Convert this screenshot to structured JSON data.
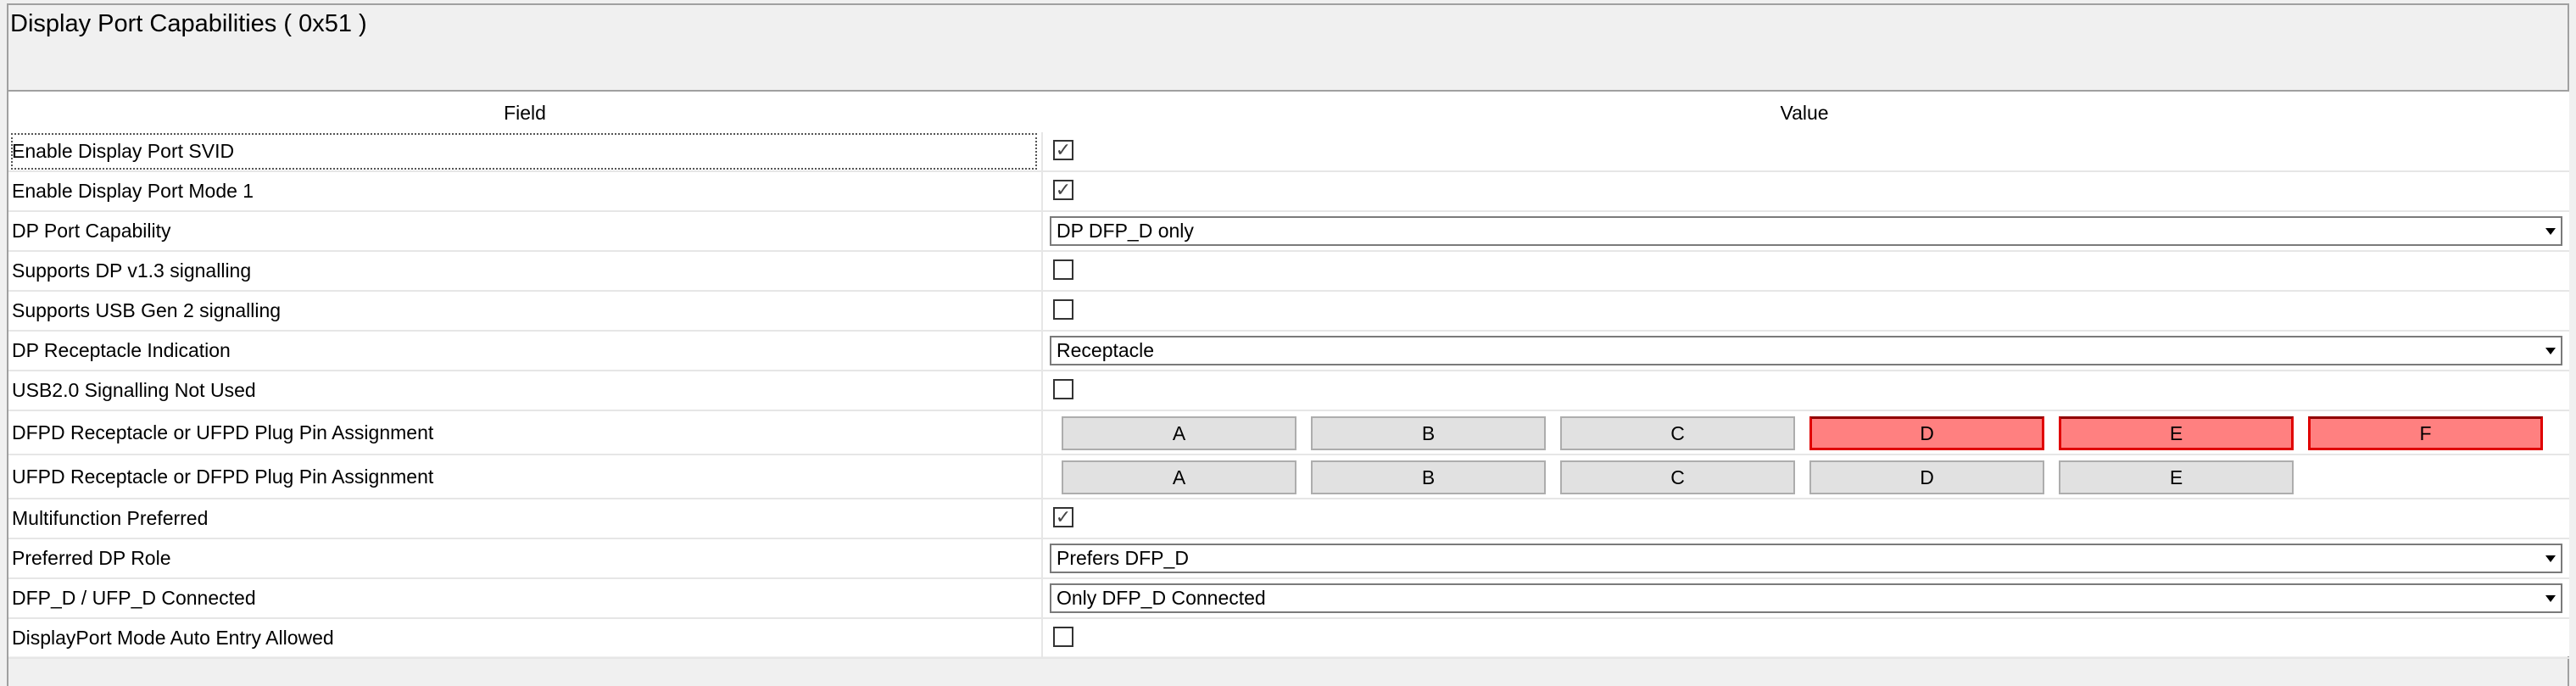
{
  "title": "Display Port Capabilities  ( 0x51 )",
  "columns": {
    "field": "Field",
    "value": "Value"
  },
  "colors": {
    "selected_pin": "#ff8080",
    "selected_pin_border": "#e00000",
    "pin_button": "#e1e1e1"
  },
  "rows": [
    {
      "label": "Enable Display Port SVID",
      "type": "checkbox",
      "checked": true
    },
    {
      "label": "Enable Display Port Mode 1",
      "type": "checkbox",
      "checked": true
    },
    {
      "label": "DP Port Capability",
      "type": "select",
      "value": "DP DFP_D only"
    },
    {
      "label": "Supports DP v1.3 signalling",
      "type": "checkbox",
      "checked": false
    },
    {
      "label": "Supports USB Gen 2 signalling",
      "type": "checkbox",
      "checked": false
    },
    {
      "label": "DP Receptacle Indication",
      "type": "select",
      "value": "Receptacle"
    },
    {
      "label": "USB2.0 Signalling Not Used",
      "type": "checkbox",
      "checked": false
    },
    {
      "label": "DFPD Receptacle or UFPD Plug Pin Assignment",
      "type": "pins",
      "pins": [
        {
          "label": "A",
          "selected": false
        },
        {
          "label": "B",
          "selected": false
        },
        {
          "label": "C",
          "selected": false
        },
        {
          "label": "D",
          "selected": true
        },
        {
          "label": "E",
          "selected": true
        },
        {
          "label": "F",
          "selected": true
        }
      ]
    },
    {
      "label": "UFPD Receptacle or DFPD Plug Pin Assignment",
      "type": "pins",
      "pins": [
        {
          "label": "A",
          "selected": false
        },
        {
          "label": "B",
          "selected": false
        },
        {
          "label": "C",
          "selected": false
        },
        {
          "label": "D",
          "selected": false
        },
        {
          "label": "E",
          "selected": false
        }
      ]
    },
    {
      "label": "Multifunction Preferred",
      "type": "checkbox",
      "checked": true
    },
    {
      "label": "Preferred DP Role",
      "type": "select",
      "value": "Prefers DFP_D"
    },
    {
      "label": "DFP_D / UFP_D Connected",
      "type": "select",
      "value": "Only DFP_D Connected"
    },
    {
      "label": "DisplayPort Mode Auto Entry Allowed",
      "type": "checkbox",
      "checked": false
    }
  ]
}
